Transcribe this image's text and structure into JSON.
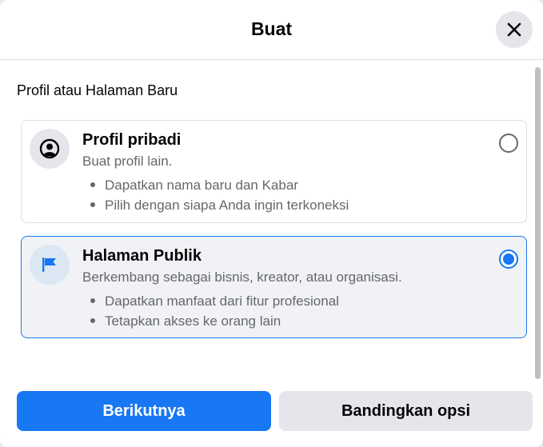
{
  "dialog": {
    "title": "Buat",
    "close_icon": "close-icon"
  },
  "section": {
    "title": "Profil atau Halaman Baru"
  },
  "options": [
    {
      "icon": "profile-icon",
      "title": "Profil pribadi",
      "description": "Buat profil lain.",
      "bullets": [
        "Dapatkan nama baru dan Kabar",
        "Pilih dengan siapa Anda ingin terkoneksi"
      ],
      "selected": false
    },
    {
      "icon": "flag-icon",
      "title": "Halaman Publik",
      "description": "Berkembang sebagai bisnis, kreator, atau organisasi.",
      "bullets": [
        "Dapatkan manfaat dari fitur profesional",
        "Tetapkan akses ke orang lain"
      ],
      "selected": true
    }
  ],
  "footer": {
    "next_label": "Berikutnya",
    "compare_label": "Bandingkan opsi"
  },
  "colors": {
    "accent": "#1877f2",
    "secondary_button": "#e4e6eb",
    "selected_background": "#f0f2f5"
  }
}
